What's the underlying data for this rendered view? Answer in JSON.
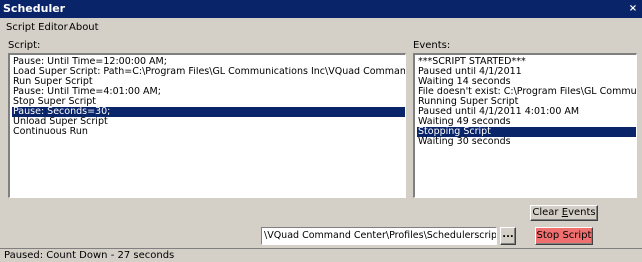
{
  "window": {
    "title": "Scheduler",
    "close_glyph": "×"
  },
  "menu": {
    "items": [
      "Script Editor",
      "About"
    ]
  },
  "script_panel": {
    "label": "Script:",
    "lines": [
      "Pause: Until Time=12:00:00 AM;",
      "Load Super Script: Path=C:\\Program Files\\GL Communications Inc\\VQuad Command Center",
      "Run Super Script",
      "Pause: Until Time=4:01:00 AM;",
      "Stop Super Script",
      "Pause: Seconds=30;",
      "Unload Super Script",
      "Continuous Run"
    ],
    "selected_index": 5
  },
  "events_panel": {
    "label": "Events:",
    "lines": [
      "***SCRIPT STARTED***",
      "Paused until 4/1/2011",
      "Waiting 14 seconds",
      "File doesn't exist: C:\\Program Files\\GL Communicati",
      "Running Super Script",
      "Paused until 4/1/2011 4:01:00 AM",
      "Waiting 49 seconds",
      "Stopping Script",
      "Waiting 30 seconds"
    ],
    "selected_index": 7
  },
  "buttons": {
    "clear_events_pre": "Clear ",
    "clear_events_key": "E",
    "clear_events_post": "vents",
    "browse": "...",
    "stop_script": "Stop Script"
  },
  "script_path": {
    "value": "\\VQuad Command Center\\Profiles\\Schedulerscript.sch"
  },
  "status": {
    "text": "Paused: Count Down - 27 seconds"
  },
  "colors": {
    "title_bar": "#0a246a",
    "selection": "#0a246a",
    "stop_button": "#f07070",
    "face": "#d4d0c8"
  }
}
